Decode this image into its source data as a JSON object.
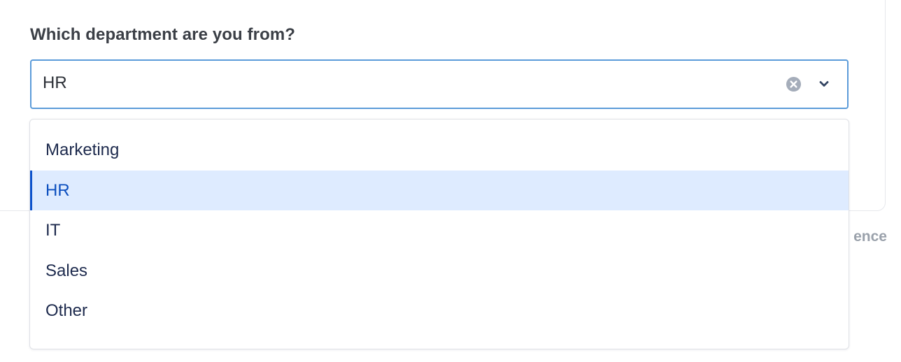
{
  "form": {
    "question": "Which department are you from?"
  },
  "select": {
    "value": "HR",
    "clear_icon": "clear-circle-icon",
    "dropdown_icon": "chevron-down-icon"
  },
  "menu": {
    "options": [
      {
        "label": "Marketing",
        "selected": false
      },
      {
        "label": "HR",
        "selected": true
      },
      {
        "label": "IT",
        "selected": false
      },
      {
        "label": "Sales",
        "selected": false
      },
      {
        "label": "Other",
        "selected": false
      }
    ]
  },
  "background": {
    "partial_text": "ence"
  },
  "colors": {
    "focus_border": "#5b9bd9",
    "selected_bg": "#deebff",
    "selected_text": "#0c4fbf",
    "selected_bar": "#0c52cc",
    "option_text": "#1d2a4d"
  }
}
